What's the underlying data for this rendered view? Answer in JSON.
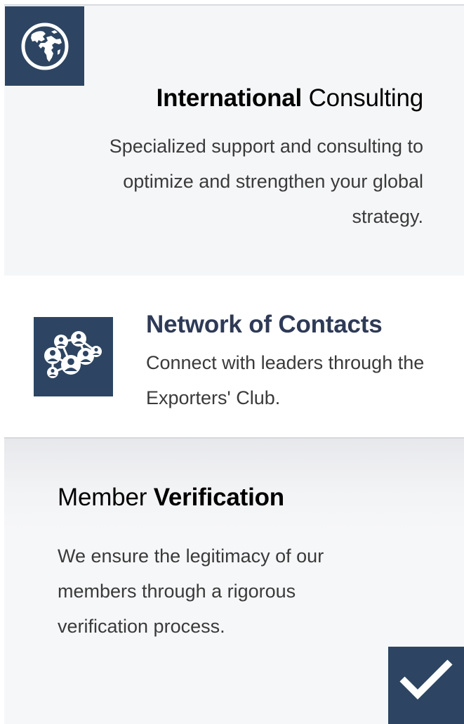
{
  "cards": [
    {
      "icon": "globe-icon",
      "title_bold": "International",
      "title_light": "Consulting",
      "description": "Specialized support and consulting to optimize and strengthen your global strategy."
    },
    {
      "icon": "network-icon",
      "title": "Network of Contacts",
      "description": "Connect with leaders through the Exporters' Club."
    },
    {
      "icon": "checkmark-icon",
      "title_light": "Member",
      "title_bold": "Verification",
      "description": "We ensure the legitimacy of our members through a rigorous verification process."
    }
  ],
  "colors": {
    "icon_background": "#2d4562",
    "network_title": "#2e3a56",
    "card_background": "#f5f6f8"
  }
}
